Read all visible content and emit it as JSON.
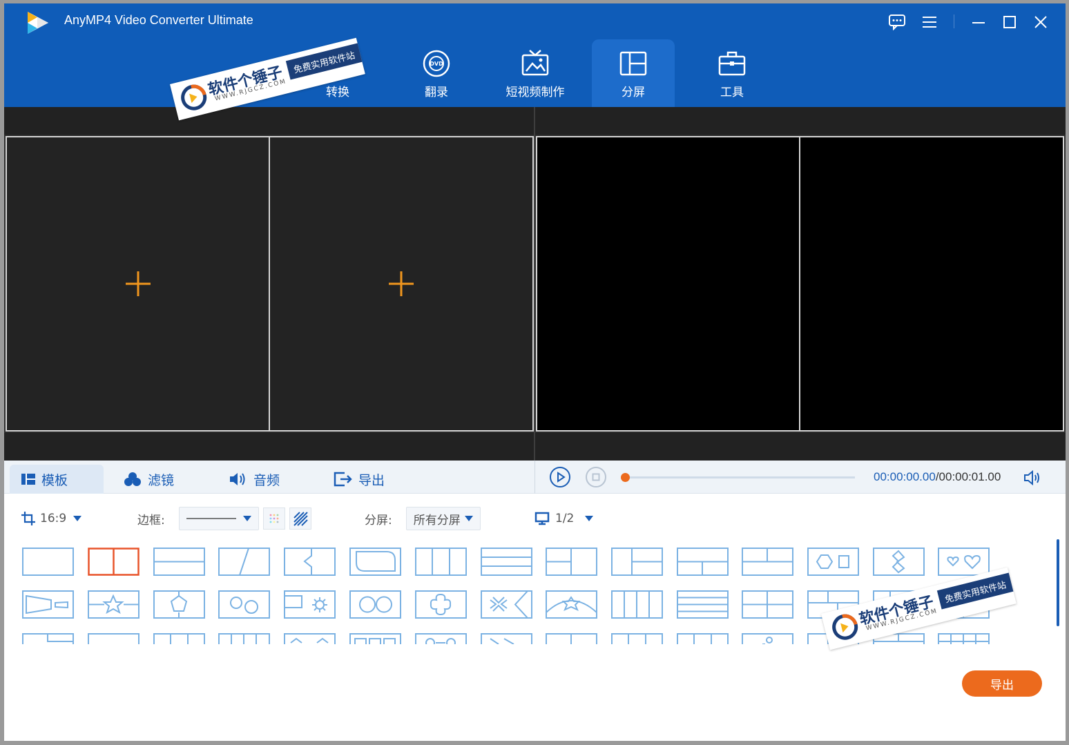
{
  "app": {
    "title": "AnyMP4 Video Converter Ultimate"
  },
  "nav": {
    "tabs": [
      {
        "label": "转换",
        "icon": "convert-icon"
      },
      {
        "label": "翻录",
        "icon": "dvd-icon"
      },
      {
        "label": "短视频制作",
        "icon": "image-frame-icon"
      },
      {
        "label": "分屏",
        "icon": "split-screen-icon",
        "active": true
      },
      {
        "label": "工具",
        "icon": "toolbox-icon"
      }
    ]
  },
  "subtabs": [
    {
      "label": "模板",
      "icon": "template-icon",
      "active": true
    },
    {
      "label": "滤镜",
      "icon": "filter-icon"
    },
    {
      "label": "音频",
      "icon": "speaker-icon"
    },
    {
      "label": "导出",
      "icon": "export-icon"
    }
  ],
  "player": {
    "current_time": "00:00:00.00",
    "total_time": "/00:00:01.00",
    "progress": 0
  },
  "options": {
    "aspect": "16:9",
    "border_label": "边框:",
    "split_label": "分屏:",
    "split_value": "所有分屏",
    "page": "1/2"
  },
  "export_button": "导出",
  "watermark": {
    "main": "软件个锤子",
    "url": "WWW.RJGCZ.COM",
    "tag": "免费实用软件站"
  },
  "colors": {
    "brand_blue": "#0f5cb8",
    "accent_orange": "#ec6a1d",
    "template_blue": "#1a5db5",
    "selected_template": "#e8542a"
  }
}
